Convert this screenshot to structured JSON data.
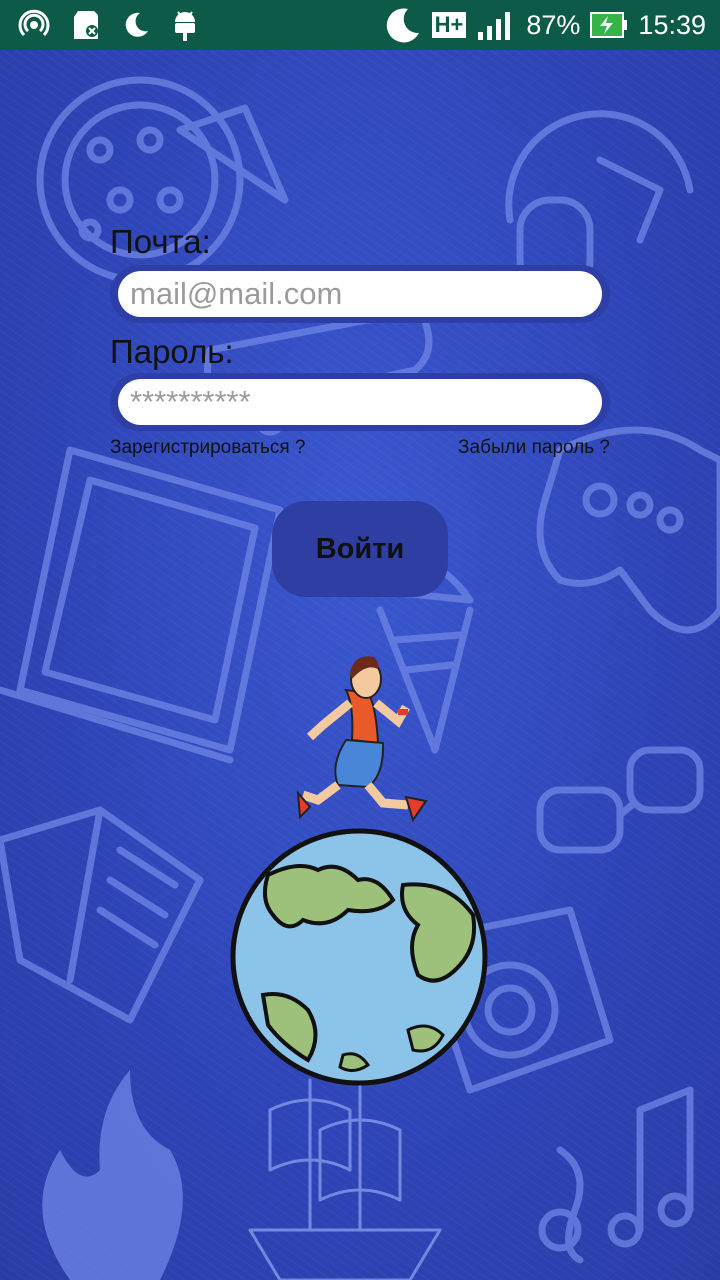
{
  "status_bar": {
    "battery": "87%",
    "network": "H+",
    "time": "15:39"
  },
  "form": {
    "email_label": "Почта:",
    "email_placeholder": "mail@mail.com",
    "password_label": "Пароль:",
    "password_placeholder": "**********",
    "register_link": "Зарегистрироваться ?",
    "forgot_link": "Забыли пароль ?",
    "login_button": "Войти"
  },
  "colors": {
    "background": "#2f46b8",
    "status_bar": "#0c5a47",
    "button": "#2e3ea3"
  },
  "background_icons": [
    "pizza-icon",
    "headphones-icon",
    "skateboard-icon",
    "laptop-icon",
    "gamepad-icon",
    "ice-cream-icon",
    "glasses-icon",
    "book-icon",
    "camera-icon",
    "fire-icon",
    "ship-icon",
    "music-notes-icon"
  ]
}
